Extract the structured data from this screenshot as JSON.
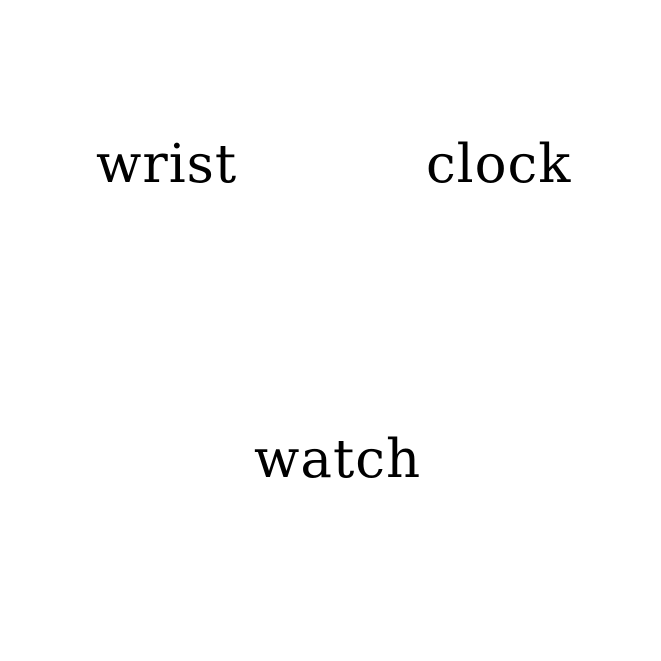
{
  "background_color": "#ffffff",
  "text_color": "#000000",
  "words": {
    "top_left": "wrist",
    "top_right": "clock",
    "bottom_center": "watch"
  }
}
